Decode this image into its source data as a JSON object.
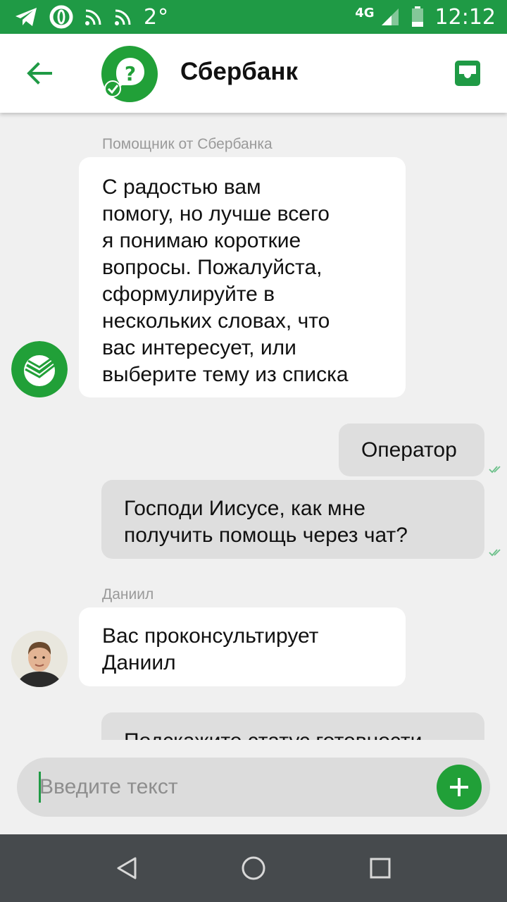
{
  "status_bar": {
    "temperature": "2°",
    "network": "4G",
    "time": "12:12",
    "icons": [
      "telegram-icon",
      "opera-icon",
      "rss-icon",
      "rss-icon",
      "signal-icon",
      "battery-icon"
    ]
  },
  "header": {
    "title": "Сбербанк",
    "back_icon": "arrow-left-icon",
    "avatar_icon": "question-chat-icon",
    "action_icon": "inbox-icon"
  },
  "messages": [
    {
      "sender": "Помощник от Сбербанка",
      "direction": "in",
      "lines": [
        "С радостью вам",
        "помогу, но лучше всего",
        "я понимаю короткие",
        "вопросы. Пожалуйста,",
        "сформулируйте в",
        "нескольких словах, что",
        "вас интересует, или",
        "выберите тему из списка"
      ]
    },
    {
      "direction": "out",
      "lines": [
        "Оператор"
      ],
      "status": "read"
    },
    {
      "direction": "out",
      "lines": [
        "Господи Иисусе, как мне",
        "получить помощь через чат?"
      ],
      "status": "read"
    },
    {
      "sender": "Даниил",
      "direction": "in",
      "lines": [
        "Вас проконсультирует",
        "Даниил"
      ]
    },
    {
      "direction": "out",
      "lines": [
        "Подскажите статус готовности"
      ]
    }
  ],
  "composer": {
    "placeholder": "Введите текст",
    "add_icon": "plus-icon"
  },
  "colors": {
    "brand_green": "#1f9a45",
    "bubble_out": "#dedede",
    "bubble_in": "#ffffff",
    "background": "#f0f0f0",
    "nav_bar": "#464a4d"
  }
}
